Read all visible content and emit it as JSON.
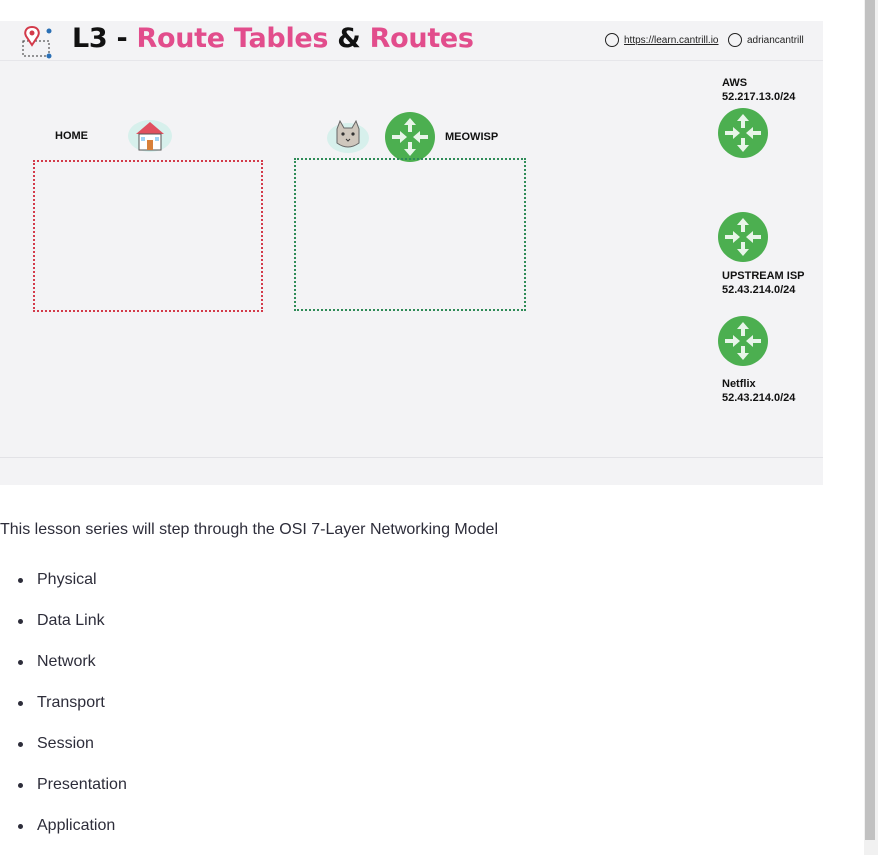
{
  "slide": {
    "title_prefix": "L3 - ",
    "title_part1": "Route Tables",
    "title_amp": " & ",
    "title_part2": "Routes",
    "link_url": "https://learn.cantrill.io",
    "link_handle": "adriancantrill",
    "home_label": "HOME",
    "meowisp_label": "MEOWISP",
    "aws": {
      "name": "AWS",
      "network": "52.217.13.0/24"
    },
    "upstream": {
      "name": "UPSTREAM ISP",
      "network": "52.43.214.0/24"
    },
    "netflix": {
      "name": "Netflix",
      "network": "52.43.214.0/24"
    },
    "colors": {
      "accent": "#e24d8c",
      "router": "#4caf50",
      "home_box": "#d33a4a",
      "isp_box": "#2e8b57"
    }
  },
  "content": {
    "intro": "This lesson series will step through the OSI 7-Layer Networking Model",
    "layers": [
      "Physical",
      "Data Link",
      "Network",
      "Transport",
      "Session",
      "Presentation",
      "Application"
    ]
  }
}
